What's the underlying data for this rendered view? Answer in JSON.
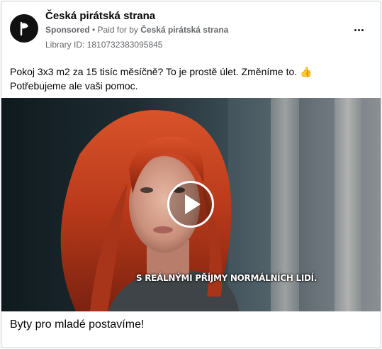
{
  "post": {
    "page_name": "Česká pirátská strana",
    "sponsored_label": "Sponsored",
    "separator": " • ",
    "paid_for_prefix": "Paid for by ",
    "paid_for_by": "Česká pirátská strana",
    "library_id": "Library ID: 1810732383095845",
    "more_icon": "more-horizontal-icon",
    "body_text": "Pokoj 3x3 m2 za 15 tisíc měsíčně? To je prostě úlet. Změníme to. 👍 Potřebujeme ale vaši pomoc.",
    "video": {
      "subtitle": "S REÁLNÝMI PŘÍJMY NORMÁLNÍCH LIDÍ.",
      "play_icon": "play-icon"
    },
    "footer_title": "Byty pro mladé postavíme!"
  },
  "colors": {
    "text_primary": "#050505",
    "text_secondary": "#65676b",
    "border": "#c9ccd1",
    "hair": "#c8401c"
  }
}
